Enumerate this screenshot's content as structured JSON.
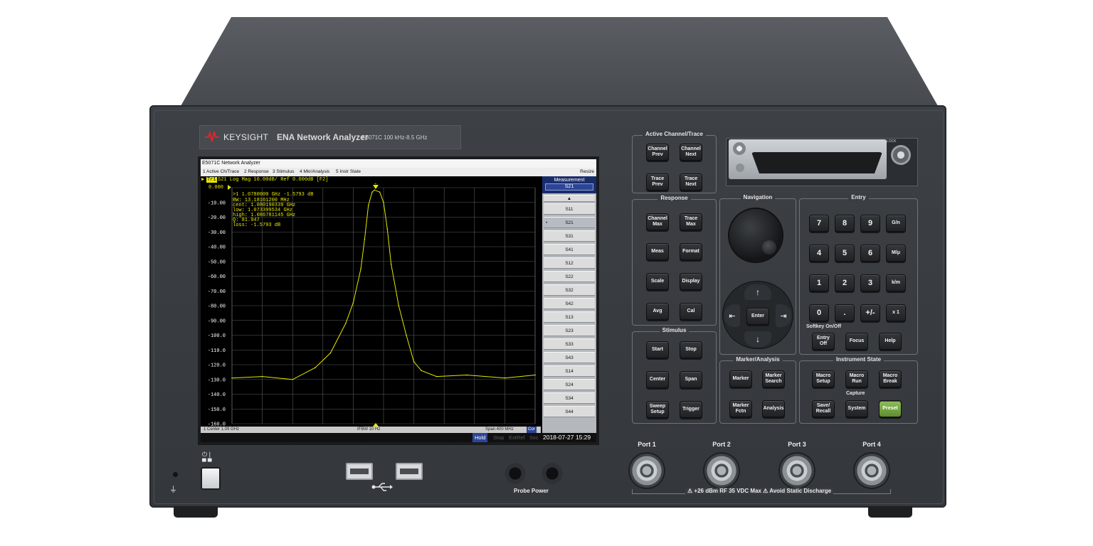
{
  "brand": {
    "name": "KEYSIGHT",
    "model": "ENA Network Analyzer",
    "sub": "E5071C   100 kHz-8.5 GHz",
    "logo_icon": "keysight-wave-logo-icon"
  },
  "window": {
    "title": "E5071C Network Analyzer",
    "menu": [
      "1 Active Ch/Trace",
      "2 Response",
      "3 Stimulus",
      "4 Mkr/Analysis",
      "5 Instr State"
    ],
    "resize_label": "Resize"
  },
  "trace": {
    "tag": "Tr1",
    "header": "S21 Log Mag 10.00dB/ Ref 0.000dB [F2]",
    "ref_label": "0.000",
    "marker_readout": [
      ">1  1.0780000 GHz -1.5793 dB",
      "  BW:  13.18161200 MHz",
      "cent:  1.080190339 GHz",
      " low:  1.073399534 GHz",
      "high:  1.086781145 GHz",
      "   Q:  81.947",
      "loss: -1.5793 dB"
    ],
    "marker_tag": "1"
  },
  "chart_data": {
    "type": "line",
    "title": "S21 Log Mag 10.00dB/ Ref 0.000dB [F2]",
    "xlabel": "",
    "ylabel": "",
    "x_center_ghz": 1.09,
    "x_span_mhz": 400,
    "xlim": [
      0.89,
      1.29
    ],
    "ylim": [
      -160,
      0
    ],
    "y_ticks": [
      "0.000",
      "-10.00",
      "-20.00",
      "-30.00",
      "-40.00",
      "-50.00",
      "-60.00",
      "-70.00",
      "-80.00",
      "-90.00",
      "-100.0",
      "-110.0",
      "-120.0",
      "-130.0",
      "-140.0",
      "-150.0",
      "-160.0"
    ],
    "grid": true,
    "series": [
      {
        "name": "S21",
        "color": "#e6e600",
        "x": [
          0.89,
          0.93,
          0.97,
          1.0,
          1.02,
          1.04,
          1.05,
          1.06,
          1.065,
          1.07,
          1.075,
          1.078,
          1.085,
          1.09,
          1.095,
          1.1,
          1.11,
          1.12,
          1.13,
          1.14,
          1.16,
          1.2,
          1.25,
          1.29
        ],
        "y": [
          -129,
          -128,
          -130,
          -122,
          -112,
          -92,
          -78,
          -55,
          -35,
          -12,
          -3,
          -1.58,
          -3,
          -10,
          -28,
          -52,
          -80,
          -100,
          -118,
          -124,
          -128,
          -127,
          -129,
          -127
        ]
      }
    ]
  },
  "softkeys": {
    "title": "Measurement",
    "selected": "S21",
    "items": [
      "S11",
      "S21",
      "S31",
      "S41",
      "S12",
      "S22",
      "S32",
      "S42",
      "S13",
      "S23",
      "S33",
      "S43",
      "S14",
      "S24",
      "S34",
      "S44"
    ]
  },
  "status": {
    "center": "1  Center 1.09 GHz",
    "ifbw": "IFBW 10 Hz",
    "span": "Span 400 MHz",
    "cor": "Cor"
  },
  "bottom": {
    "hold": "Hold",
    "stop": "Stop",
    "extref": "ExtRef",
    "svc": "Svc",
    "datetime": "2018-07-27 15:29"
  },
  "panel": {
    "active": {
      "title": "Active Channel/Trace",
      "keys": [
        "Channel\nPrev",
        "Channel\nNext",
        "Trace\nPrev",
        "Trace\nNext"
      ]
    },
    "response": {
      "title": "Response",
      "keys": [
        "Channel\nMax",
        "Trace\nMax",
        "Meas",
        "Format",
        "Scale",
        "Display",
        "Avg",
        "Cal"
      ]
    },
    "stimulus": {
      "title": "Stimulus",
      "keys": [
        "Start",
        "Stop",
        "Center",
        "Span",
        "Sweep\nSetup",
        "Trigger"
      ]
    },
    "navigation": {
      "title": "Navigation",
      "enter": "Enter"
    },
    "marker": {
      "title": "Marker/Analysis",
      "keys": [
        "Marker",
        "Marker\nSearch",
        "Marker\nFctn",
        "Analysis"
      ]
    },
    "entry": {
      "title": "Entry",
      "keys": [
        "7",
        "8",
        "9",
        "G/n",
        "4",
        "5",
        "6",
        "M/μ",
        "1",
        "2",
        "3",
        "k/m",
        "0",
        ".",
        "+/-",
        "x 1"
      ],
      "softkey_label": "Softkey On/Off",
      "keys2": [
        "Entry\nOff",
        "Focus",
        "Help"
      ]
    },
    "instr": {
      "title": "Instrument State",
      "keys": [
        "Macro\nSetup",
        "Macro\nRun",
        "Macro\nBreak",
        "Save/\nRecall",
        "System",
        "Preset"
      ],
      "capture": "Capture"
    },
    "lock": "LOCK"
  },
  "ports": {
    "labels": [
      "Port 1",
      "Port 2",
      "Port 3",
      "Port 4"
    ],
    "warning": "+26 dBm RF  35 VDC Max",
    "static": "Avoid Static Discharge"
  },
  "probe": {
    "label": "Probe Power"
  }
}
